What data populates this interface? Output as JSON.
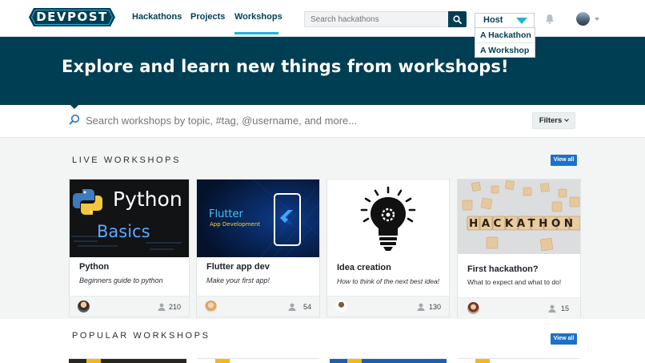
{
  "header": {
    "logo_text": "DEVPOST",
    "nav": [
      "Hackathons",
      "Projects",
      "Workshops"
    ],
    "active_nav": "Workshops",
    "search_placeholder": "Search hackathons",
    "host_label": "Host",
    "host_menu": [
      "A Hackathon",
      "A Workshop"
    ]
  },
  "hero": {
    "title": "Explore and learn new things from workshops!"
  },
  "workshop_search": {
    "placeholder": "Search workshops by topic, #tag, @username, and more...",
    "filters_label": "Filters"
  },
  "live": {
    "title": "LIVE WORKSHOPS",
    "view_all": "View all",
    "cards": [
      {
        "title": "Python",
        "subtitle": "Beginners guide to python",
        "count": "210",
        "thumb_line1": "Python",
        "thumb_line2": "Basics"
      },
      {
        "title": "Flutter app dev",
        "subtitle": "Make your first app!",
        "count": "54",
        "thumb_line1": "Flutter",
        "thumb_line2": "App Development"
      },
      {
        "title": "Idea creation",
        "subtitle": "How to think of the next best idea!",
        "count": "130"
      },
      {
        "title": "First hackathon?",
        "subtitle": "What to expect and what to do!",
        "count": "15",
        "thumb_word": "HACKATHON"
      }
    ]
  },
  "popular": {
    "title": "POPULAR WORKSHOPS",
    "view_all": "View all"
  },
  "colors": {
    "brand_dark": "#003e54",
    "accent": "#1fb4d8",
    "button_blue": "#1b72c9"
  }
}
